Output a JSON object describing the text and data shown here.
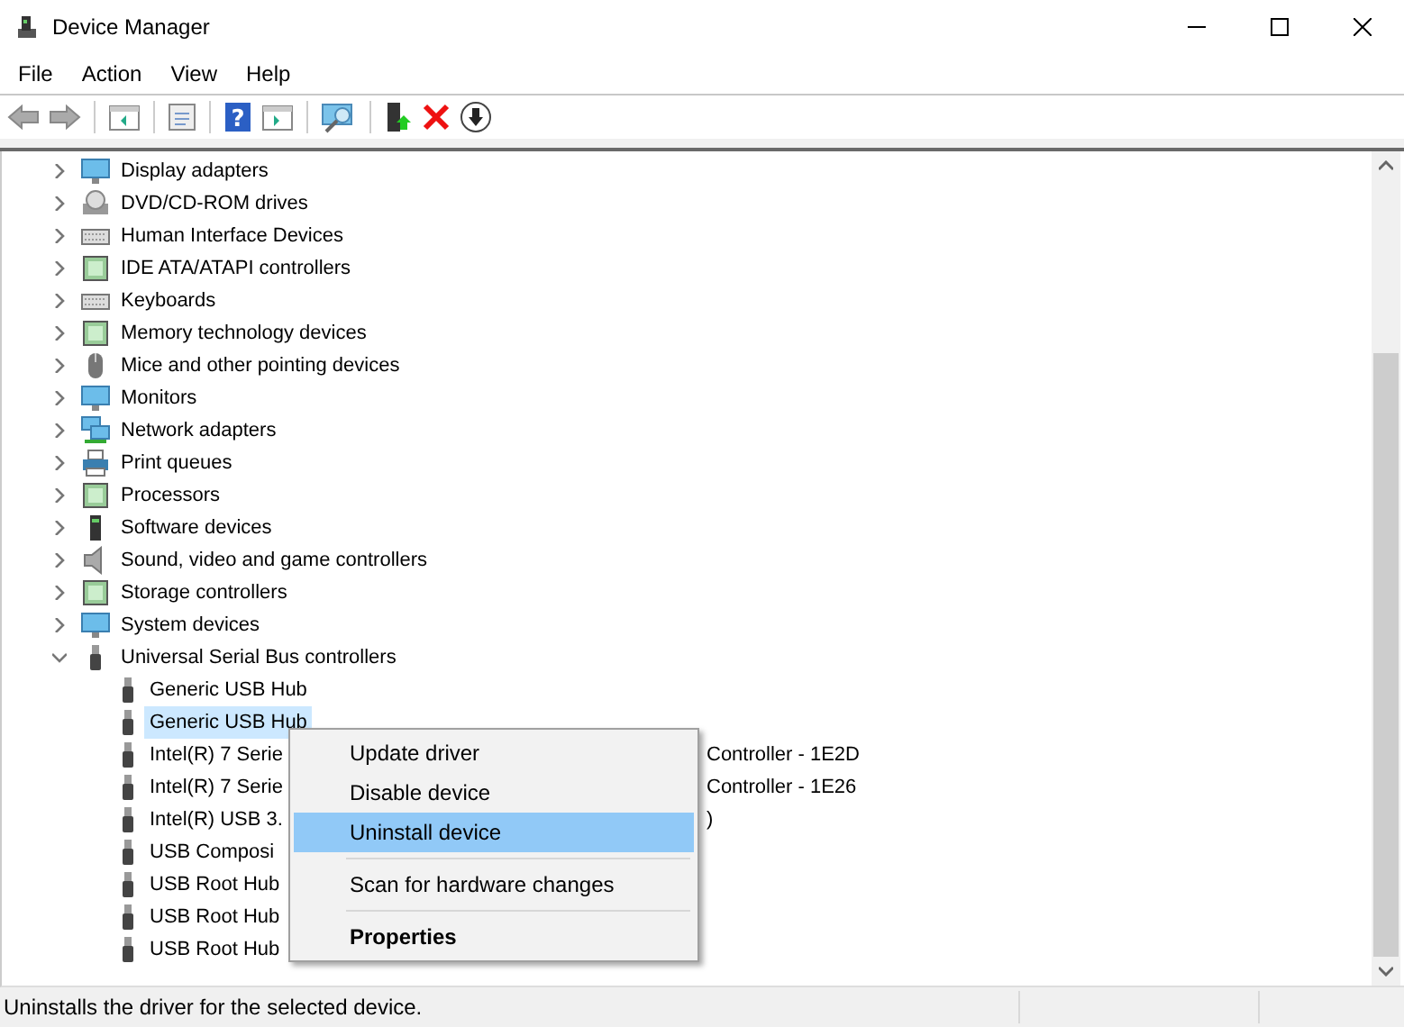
{
  "window": {
    "title": "Device Manager"
  },
  "menu": [
    "File",
    "Action",
    "View",
    "Help"
  ],
  "toolbar": {
    "help_glyph": "?"
  },
  "tree": [
    {
      "label": "Display adapters",
      "expanded": false
    },
    {
      "label": "DVD/CD-ROM drives",
      "expanded": false
    },
    {
      "label": "Human Interface Devices",
      "expanded": false
    },
    {
      "label": "IDE ATA/ATAPI controllers",
      "expanded": false
    },
    {
      "label": "Keyboards",
      "expanded": false
    },
    {
      "label": "Memory technology devices",
      "expanded": false
    },
    {
      "label": "Mice and other pointing devices",
      "expanded": false
    },
    {
      "label": "Monitors",
      "expanded": false
    },
    {
      "label": "Network adapters",
      "expanded": false
    },
    {
      "label": "Print queues",
      "expanded": false
    },
    {
      "label": "Processors",
      "expanded": false
    },
    {
      "label": "Software devices",
      "expanded": false
    },
    {
      "label": "Sound, video and game controllers",
      "expanded": false
    },
    {
      "label": "Storage controllers",
      "expanded": false
    },
    {
      "label": "System devices",
      "expanded": false
    },
    {
      "label": "Universal Serial Bus controllers",
      "expanded": true,
      "children": [
        {
          "label": "Generic USB Hub",
          "selected": false
        },
        {
          "label": "Generic USB Hub",
          "selected": true
        },
        {
          "label": "Intel(R) 7 Serie",
          "tail": "Controller - 1E2D",
          "selected": false
        },
        {
          "label": "Intel(R) 7 Serie",
          "tail": "Controller - 1E26",
          "selected": false
        },
        {
          "label": "Intel(R) USB 3.",
          "tail": ")",
          "selected": false
        },
        {
          "label": "USB Composi",
          "selected": false
        },
        {
          "label": "USB Root Hub",
          "selected": false
        },
        {
          "label": "USB Root Hub",
          "selected": false
        },
        {
          "label": "USB Root Hub",
          "selected": false
        }
      ]
    }
  ],
  "context_menu": [
    {
      "label": "Update driver",
      "selected": false,
      "separator_before": false,
      "default": false
    },
    {
      "label": "Disable device",
      "selected": false,
      "separator_before": false,
      "default": false
    },
    {
      "label": "Uninstall device",
      "selected": true,
      "separator_before": false,
      "default": false
    },
    {
      "label": "Scan for hardware changes",
      "selected": false,
      "separator_before": true,
      "default": false
    },
    {
      "label": "Properties",
      "selected": false,
      "separator_before": true,
      "default": true
    }
  ],
  "status_bar": "Uninstalls the driver for the selected device."
}
